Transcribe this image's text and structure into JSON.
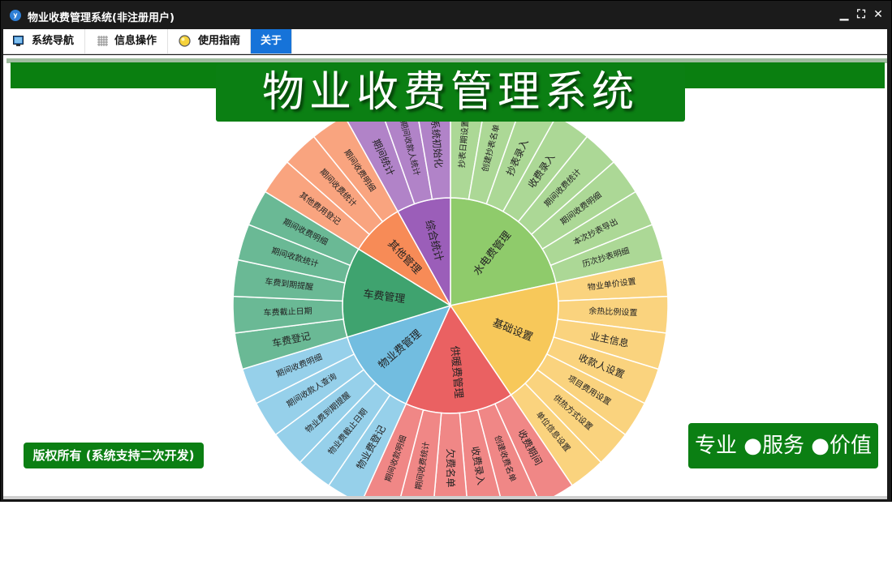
{
  "window": {
    "title": "物业收费管理系统(非注册用户)",
    "app_icon": "y",
    "controls": {
      "minimize": "▁",
      "restore": "⛶",
      "close": "✕"
    }
  },
  "menu": {
    "tabs": [
      {
        "label": "系统导航",
        "icon": "monitor-icon"
      },
      {
        "label": "信息操作",
        "icon": "grid-icon"
      },
      {
        "label": "使用指南",
        "icon": "bulb-icon"
      },
      {
        "label": "关于",
        "icon": ""
      }
    ],
    "active_index": 3
  },
  "banner": {
    "title": "物业收费管理系统"
  },
  "footer": {
    "copyright": "版权所有 (系统支持二次开发)",
    "slogan": "专业 ●服务 ●价值"
  },
  "colors": {
    "green": "#0b7f13",
    "titlebar": "#1b1b1b",
    "active_tab": "#1673d9"
  },
  "sunburst": {
    "groups": [
      {
        "name": "水电费管理",
        "color": "#8fcb6b",
        "outer": "#acd896",
        "items": [
          "抄表日期设置",
          "创建抄表名单",
          "抄表录入",
          "收费录入",
          "期间收费统计",
          "期间收费明细",
          "本次抄表导出",
          "历次抄表明细"
        ]
      },
      {
        "name": "基础设置",
        "color": "#f7c85a",
        "outer": "#fad37e",
        "items": [
          "物业单价设置",
          "余热比例设置",
          "业主信息",
          "收款人设置",
          "项目费用设置",
          "供热方式设置",
          "单位信息设置"
        ]
      },
      {
        "name": "供暖费管理",
        "color": "#ea6162",
        "outer": "#f08786",
        "items": [
          "收费期间",
          "创建收费名单",
          "收费录入",
          "欠费名单",
          "期间收费统计",
          "期间收款明细"
        ]
      },
      {
        "name": "物业费管理",
        "color": "#72bde0",
        "outer": "#96d0ea",
        "items": [
          "物业费登记",
          "物业费截止日期",
          "物业费到期提醒",
          "期间收款人查询",
          "期间收费明细"
        ]
      },
      {
        "name": "车费管理",
        "color": "#3fa36f",
        "outer": "#6ab995",
        "items": [
          "车费登记",
          "车费截止日期",
          "车费到期提醒",
          "期间收款统计",
          "期间收费明细"
        ]
      },
      {
        "name": "其他管理",
        "color": "#f78b57",
        "outer": "#f9a47f",
        "items": [
          "其他费用登记",
          "期间收费统计",
          "期间收费明细"
        ]
      },
      {
        "name": "综合统计",
        "color": "#9b5eb9",
        "outer": "#b183c8",
        "items": [
          "期间统计",
          "期间收款人统计",
          "系统初始化"
        ]
      }
    ]
  }
}
